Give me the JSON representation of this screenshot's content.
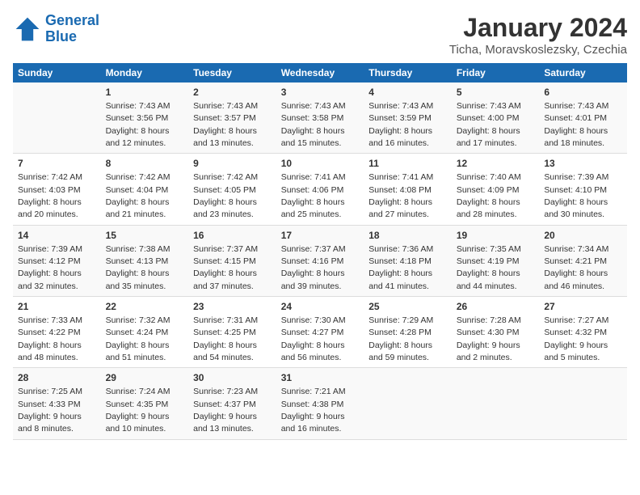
{
  "logo": {
    "line1": "General",
    "line2": "Blue"
  },
  "title": "January 2024",
  "subtitle": "Ticha, Moravskoslezsky, Czechia",
  "days": [
    "Sunday",
    "Monday",
    "Tuesday",
    "Wednesday",
    "Thursday",
    "Friday",
    "Saturday"
  ],
  "weeks": [
    [
      {
        "num": "",
        "sunrise": "",
        "sunset": "",
        "daylight": ""
      },
      {
        "num": "1",
        "sunrise": "Sunrise: 7:43 AM",
        "sunset": "Sunset: 3:56 PM",
        "daylight": "Daylight: 8 hours and 12 minutes."
      },
      {
        "num": "2",
        "sunrise": "Sunrise: 7:43 AM",
        "sunset": "Sunset: 3:57 PM",
        "daylight": "Daylight: 8 hours and 13 minutes."
      },
      {
        "num": "3",
        "sunrise": "Sunrise: 7:43 AM",
        "sunset": "Sunset: 3:58 PM",
        "daylight": "Daylight: 8 hours and 15 minutes."
      },
      {
        "num": "4",
        "sunrise": "Sunrise: 7:43 AM",
        "sunset": "Sunset: 3:59 PM",
        "daylight": "Daylight: 8 hours and 16 minutes."
      },
      {
        "num": "5",
        "sunrise": "Sunrise: 7:43 AM",
        "sunset": "Sunset: 4:00 PM",
        "daylight": "Daylight: 8 hours and 17 minutes."
      },
      {
        "num": "6",
        "sunrise": "Sunrise: 7:43 AM",
        "sunset": "Sunset: 4:01 PM",
        "daylight": "Daylight: 8 hours and 18 minutes."
      }
    ],
    [
      {
        "num": "7",
        "sunrise": "Sunrise: 7:42 AM",
        "sunset": "Sunset: 4:03 PM",
        "daylight": "Daylight: 8 hours and 20 minutes."
      },
      {
        "num": "8",
        "sunrise": "Sunrise: 7:42 AM",
        "sunset": "Sunset: 4:04 PM",
        "daylight": "Daylight: 8 hours and 21 minutes."
      },
      {
        "num": "9",
        "sunrise": "Sunrise: 7:42 AM",
        "sunset": "Sunset: 4:05 PM",
        "daylight": "Daylight: 8 hours and 23 minutes."
      },
      {
        "num": "10",
        "sunrise": "Sunrise: 7:41 AM",
        "sunset": "Sunset: 4:06 PM",
        "daylight": "Daylight: 8 hours and 25 minutes."
      },
      {
        "num": "11",
        "sunrise": "Sunrise: 7:41 AM",
        "sunset": "Sunset: 4:08 PM",
        "daylight": "Daylight: 8 hours and 27 minutes."
      },
      {
        "num": "12",
        "sunrise": "Sunrise: 7:40 AM",
        "sunset": "Sunset: 4:09 PM",
        "daylight": "Daylight: 8 hours and 28 minutes."
      },
      {
        "num": "13",
        "sunrise": "Sunrise: 7:39 AM",
        "sunset": "Sunset: 4:10 PM",
        "daylight": "Daylight: 8 hours and 30 minutes."
      }
    ],
    [
      {
        "num": "14",
        "sunrise": "Sunrise: 7:39 AM",
        "sunset": "Sunset: 4:12 PM",
        "daylight": "Daylight: 8 hours and 32 minutes."
      },
      {
        "num": "15",
        "sunrise": "Sunrise: 7:38 AM",
        "sunset": "Sunset: 4:13 PM",
        "daylight": "Daylight: 8 hours and 35 minutes."
      },
      {
        "num": "16",
        "sunrise": "Sunrise: 7:37 AM",
        "sunset": "Sunset: 4:15 PM",
        "daylight": "Daylight: 8 hours and 37 minutes."
      },
      {
        "num": "17",
        "sunrise": "Sunrise: 7:37 AM",
        "sunset": "Sunset: 4:16 PM",
        "daylight": "Daylight: 8 hours and 39 minutes."
      },
      {
        "num": "18",
        "sunrise": "Sunrise: 7:36 AM",
        "sunset": "Sunset: 4:18 PM",
        "daylight": "Daylight: 8 hours and 41 minutes."
      },
      {
        "num": "19",
        "sunrise": "Sunrise: 7:35 AM",
        "sunset": "Sunset: 4:19 PM",
        "daylight": "Daylight: 8 hours and 44 minutes."
      },
      {
        "num": "20",
        "sunrise": "Sunrise: 7:34 AM",
        "sunset": "Sunset: 4:21 PM",
        "daylight": "Daylight: 8 hours and 46 minutes."
      }
    ],
    [
      {
        "num": "21",
        "sunrise": "Sunrise: 7:33 AM",
        "sunset": "Sunset: 4:22 PM",
        "daylight": "Daylight: 8 hours and 48 minutes."
      },
      {
        "num": "22",
        "sunrise": "Sunrise: 7:32 AM",
        "sunset": "Sunset: 4:24 PM",
        "daylight": "Daylight: 8 hours and 51 minutes."
      },
      {
        "num": "23",
        "sunrise": "Sunrise: 7:31 AM",
        "sunset": "Sunset: 4:25 PM",
        "daylight": "Daylight: 8 hours and 54 minutes."
      },
      {
        "num": "24",
        "sunrise": "Sunrise: 7:30 AM",
        "sunset": "Sunset: 4:27 PM",
        "daylight": "Daylight: 8 hours and 56 minutes."
      },
      {
        "num": "25",
        "sunrise": "Sunrise: 7:29 AM",
        "sunset": "Sunset: 4:28 PM",
        "daylight": "Daylight: 8 hours and 59 minutes."
      },
      {
        "num": "26",
        "sunrise": "Sunrise: 7:28 AM",
        "sunset": "Sunset: 4:30 PM",
        "daylight": "Daylight: 9 hours and 2 minutes."
      },
      {
        "num": "27",
        "sunrise": "Sunrise: 7:27 AM",
        "sunset": "Sunset: 4:32 PM",
        "daylight": "Daylight: 9 hours and 5 minutes."
      }
    ],
    [
      {
        "num": "28",
        "sunrise": "Sunrise: 7:25 AM",
        "sunset": "Sunset: 4:33 PM",
        "daylight": "Daylight: 9 hours and 8 minutes."
      },
      {
        "num": "29",
        "sunrise": "Sunrise: 7:24 AM",
        "sunset": "Sunset: 4:35 PM",
        "daylight": "Daylight: 9 hours and 10 minutes."
      },
      {
        "num": "30",
        "sunrise": "Sunrise: 7:23 AM",
        "sunset": "Sunset: 4:37 PM",
        "daylight": "Daylight: 9 hours and 13 minutes."
      },
      {
        "num": "31",
        "sunrise": "Sunrise: 7:21 AM",
        "sunset": "Sunset: 4:38 PM",
        "daylight": "Daylight: 9 hours and 16 minutes."
      },
      {
        "num": "",
        "sunrise": "",
        "sunset": "",
        "daylight": ""
      },
      {
        "num": "",
        "sunrise": "",
        "sunset": "",
        "daylight": ""
      },
      {
        "num": "",
        "sunrise": "",
        "sunset": "",
        "daylight": ""
      }
    ]
  ]
}
